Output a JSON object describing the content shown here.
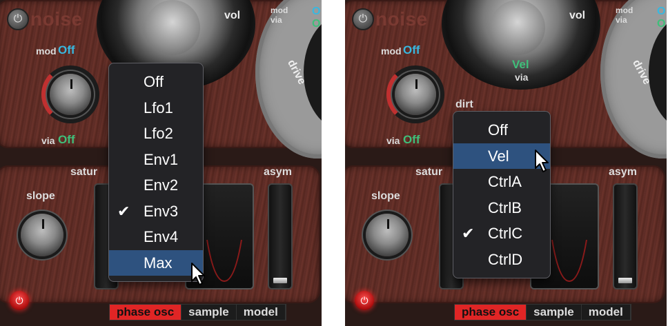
{
  "colors": {
    "menu_bg": "#232326",
    "menu_highlight": "#2e527f",
    "mod_value_blue": "#38b8e0",
    "via_value_green": "#3fbf7a",
    "tab_active_red": "#e02525"
  },
  "left": {
    "title": "noise",
    "top_knob": {
      "mod_label": "mod",
      "mod_value": "Off",
      "via_label": "via",
      "via_value": "Off"
    },
    "dial_label": "vol",
    "mod_via": {
      "mod": "mod",
      "via": "via"
    },
    "drive_label": "drive",
    "section_labels": {
      "satur": "satur",
      "asym": "asym",
      "slope": "slope"
    },
    "tabs": [
      {
        "label": "phase osc",
        "active": true
      },
      {
        "label": "sample",
        "active": false
      },
      {
        "label": "model",
        "active": false
      }
    ],
    "menu": {
      "items": [
        {
          "label": "Off",
          "checked": false,
          "highlighted": false
        },
        {
          "label": "Lfo1",
          "checked": false,
          "highlighted": false
        },
        {
          "label": "Lfo2",
          "checked": false,
          "highlighted": false
        },
        {
          "label": "Env1",
          "checked": false,
          "highlighted": false
        },
        {
          "label": "Env2",
          "checked": false,
          "highlighted": false
        },
        {
          "label": "Env3",
          "checked": true,
          "highlighted": false
        },
        {
          "label": "Env4",
          "checked": false,
          "highlighted": false
        },
        {
          "label": "Max",
          "checked": false,
          "highlighted": true
        }
      ]
    }
  },
  "right": {
    "title": "noise",
    "top_knob": {
      "mod_label": "mod",
      "mod_value": "Off",
      "via_label": "via",
      "via_value": "Off"
    },
    "dial_label": "vol",
    "dial_source": "Vel",
    "dial_via": "via",
    "mod_via": {
      "mod": "mod",
      "via": "via"
    },
    "drive_label": "drive",
    "dirt_label": "dirt",
    "section_labels": {
      "satur": "satur",
      "asym": "asym",
      "slope": "slope"
    },
    "tabs": [
      {
        "label": "phase osc",
        "active": true
      },
      {
        "label": "sample",
        "active": false
      },
      {
        "label": "model",
        "active": false
      }
    ],
    "menu": {
      "items": [
        {
          "label": "Off",
          "checked": false,
          "highlighted": false
        },
        {
          "label": "Vel",
          "checked": false,
          "highlighted": true
        },
        {
          "label": "CtrlA",
          "checked": false,
          "highlighted": false
        },
        {
          "label": "CtrlB",
          "checked": false,
          "highlighted": false
        },
        {
          "label": "CtrlC",
          "checked": true,
          "highlighted": false
        },
        {
          "label": "CtrlD",
          "checked": false,
          "highlighted": false
        }
      ]
    }
  },
  "icons": {
    "power": "power-icon",
    "checkmark": "checkmark-icon",
    "cursor": "cursor-icon"
  }
}
